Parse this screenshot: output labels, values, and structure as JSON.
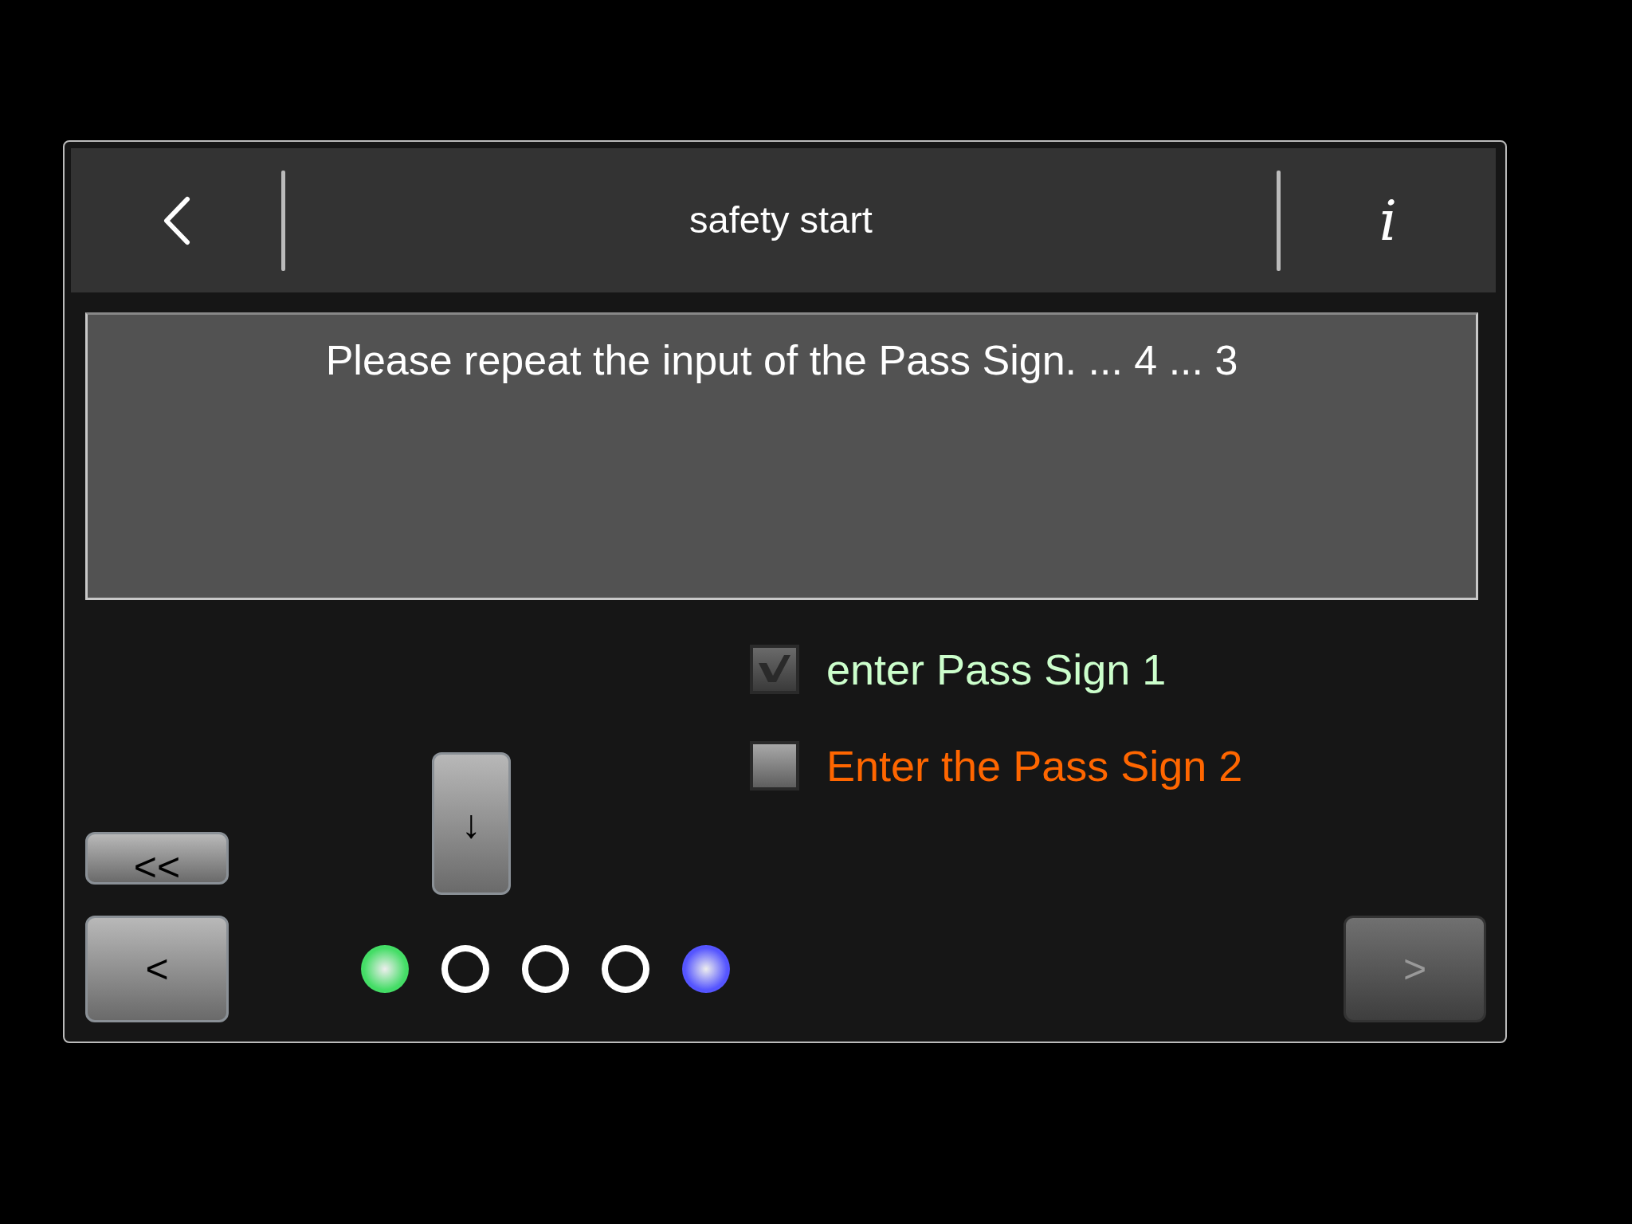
{
  "header": {
    "title": "safety start",
    "info": "i"
  },
  "message": "Please repeat the input of the Pass Sign. ... 4 ... 3",
  "steps": [
    {
      "label": "enter Pass Sign 1",
      "checked": true,
      "color": "#ccffcc"
    },
    {
      "label": "Enter the Pass Sign 2",
      "checked": false,
      "color": "#ff6600"
    }
  ],
  "buttons": {
    "first": {
      "label": "<<",
      "disabled": false
    },
    "previous": {
      "label": "<",
      "disabled": false
    },
    "down": {
      "label": "↓",
      "disabled": false
    },
    "next": {
      "label": ">",
      "disabled": true
    }
  },
  "dots": [
    {
      "kind": "filled",
      "color": "#44dd66"
    },
    {
      "kind": "ring",
      "color": "#ffffff"
    },
    {
      "kind": "ring",
      "color": "#ffffff"
    },
    {
      "kind": "ring",
      "color": "#ffffff"
    },
    {
      "kind": "filled",
      "color": "#5555ff"
    }
  ]
}
